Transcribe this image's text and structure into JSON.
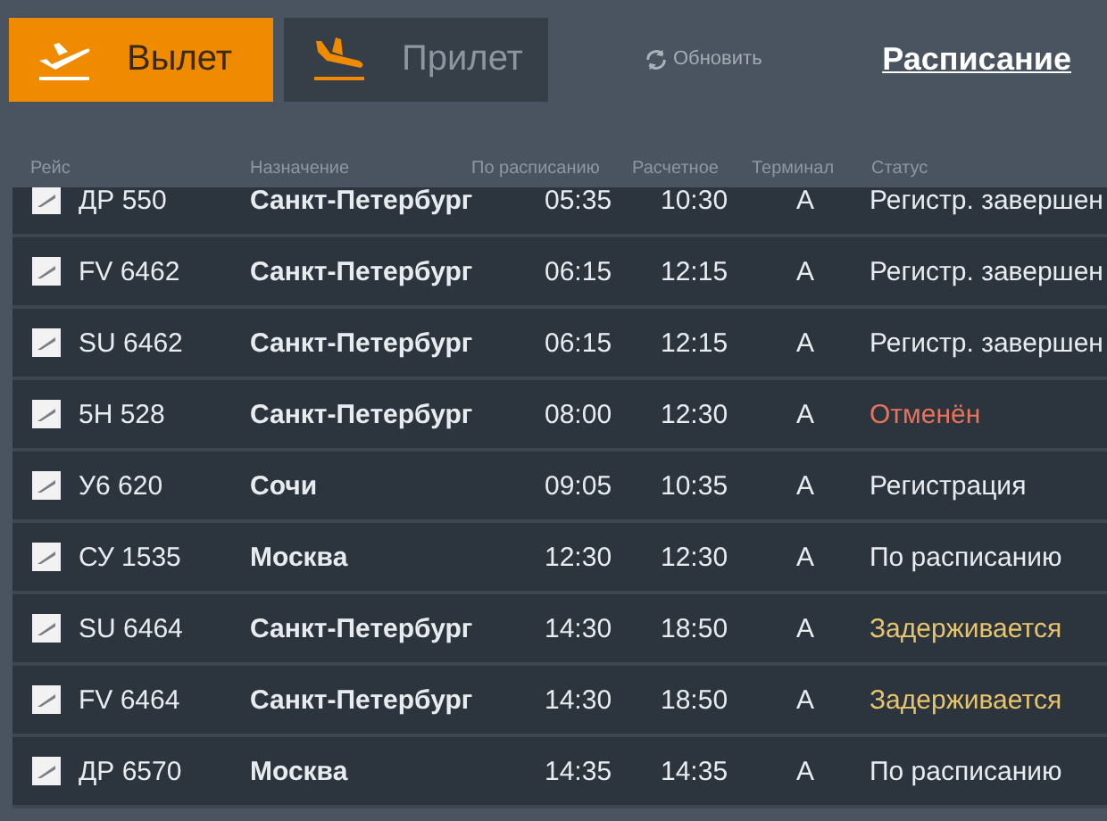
{
  "tabs": [
    {
      "label": "Вылет",
      "kind": "departure",
      "selected": true
    },
    {
      "label": "Прилет",
      "kind": "arrival",
      "selected": false
    }
  ],
  "refresh": "Обновить",
  "schedule_link": "Расписание",
  "table": {
    "columns": [
      "Рейс",
      "Назначение",
      "По расписанию",
      "Расчетное",
      "Терминал",
      "Статус"
    ],
    "rows": [
      {
        "flight": "ДР 550",
        "destination": "Санкт-Петербург",
        "scheduled": "05:35",
        "estimated": "10:30",
        "terminal": "A",
        "status": "Регистр. завершен",
        "kind": "normal"
      },
      {
        "flight": "FV 6462",
        "destination": "Санкт-Петербург",
        "scheduled": "06:15",
        "estimated": "12:15",
        "terminal": "A",
        "status": "Регистр. завершен",
        "kind": "normal"
      },
      {
        "flight": "SU 6462",
        "destination": "Санкт-Петербург",
        "scheduled": "06:15",
        "estimated": "12:15",
        "terminal": "A",
        "status": "Регистр. завершен",
        "kind": "normal"
      },
      {
        "flight": "5H 528",
        "destination": "Санкт-Петербург",
        "scheduled": "08:00",
        "estimated": "12:30",
        "terminal": "A",
        "status": "Отменён",
        "kind": "cancelled"
      },
      {
        "flight": "У6 620",
        "destination": "Сочи",
        "scheduled": "09:05",
        "estimated": "10:35",
        "terminal": "A",
        "status": "Регистрация",
        "kind": "normal"
      },
      {
        "flight": "СУ 1535",
        "destination": "Москва",
        "scheduled": "12:30",
        "estimated": "12:30",
        "terminal": "A",
        "status": "По расписанию",
        "kind": "normal"
      },
      {
        "flight": "SU 6464",
        "destination": "Санкт-Петербург",
        "scheduled": "14:30",
        "estimated": "18:50",
        "terminal": "A",
        "status": "Задерживается",
        "kind": "delayed"
      },
      {
        "flight": "FV 6464",
        "destination": "Санкт-Петербург",
        "scheduled": "14:30",
        "estimated": "18:50",
        "terminal": "A",
        "status": "Задерживается",
        "kind": "delayed"
      },
      {
        "flight": "ДР 6570",
        "destination": "Москва",
        "scheduled": "14:35",
        "estimated": "14:35",
        "terminal": "A",
        "status": "По расписанию",
        "kind": "normal"
      }
    ]
  }
}
